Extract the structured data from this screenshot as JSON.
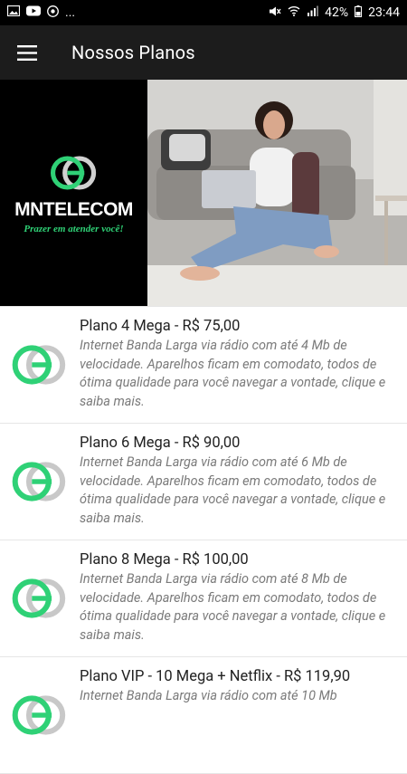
{
  "status": {
    "battery": "42%",
    "time": "23:44",
    "more": "..."
  },
  "appbar": {
    "title": "Nossos Planos"
  },
  "banner": {
    "brand": "MNTELECOM",
    "slogan": "Prazer em atender você!"
  },
  "plans": [
    {
      "title": "Plano 4 Mega - R$ 75,00",
      "desc": "Internet Banda Larga via rádio com até 4 Mb de velocidade. Aparelhos ficam em comodato, todos de ótima qualidade para você navegar a vontade, clique e saiba mais."
    },
    {
      "title": "Plano 6 Mega - R$ 90,00",
      "desc": "Internet Banda Larga via rádio com até 6 Mb de velocidade. Aparelhos ficam em comodato, todos de ótima qualidade para você navegar a vontade, clique e saiba mais."
    },
    {
      "title": "Plano 8 Mega - R$ 100,00",
      "desc": "Internet Banda Larga via rádio com até 8 Mb de velocidade. Aparelhos ficam em comodato, todos de ótima qualidade para você navegar a vontade, clique e saiba mais."
    },
    {
      "title": "Plano VIP - 10 Mega + Netflix - R$ 119,90",
      "desc": "Internet Banda Larga via rádio com até 10 Mb"
    }
  ],
  "colors": {
    "accent": "#2fd176",
    "logo_gray": "#c8c8c8",
    "appbar": "#1c1c1c"
  }
}
